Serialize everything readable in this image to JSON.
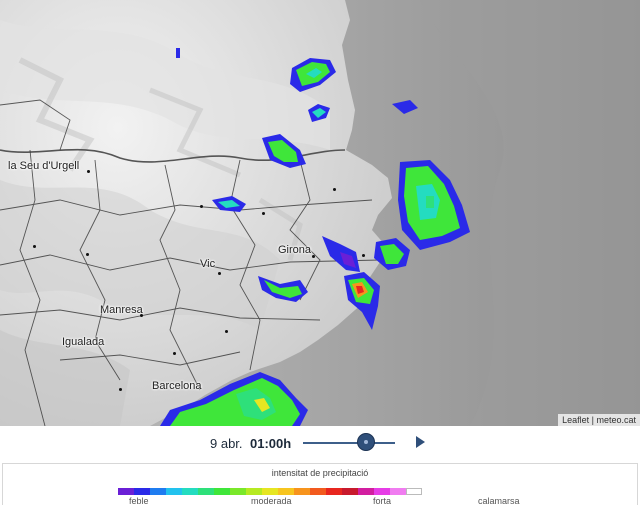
{
  "map": {
    "places": [
      {
        "id": "seu",
        "name": "la Seu d'Urgell"
      },
      {
        "id": "girona",
        "name": "Girona"
      },
      {
        "id": "vic",
        "name": "Vic"
      },
      {
        "id": "manresa",
        "name": "Manresa"
      },
      {
        "id": "igualada",
        "name": "Igualada"
      },
      {
        "id": "barcelona",
        "name": "Barcelona"
      }
    ],
    "attribution": {
      "leaflet": "Leaflet",
      "separator": "|",
      "source": "meteo.cat"
    }
  },
  "timebar": {
    "date": "9 abr.",
    "hour": "01:00h",
    "play_icon": "play-icon"
  },
  "legend": {
    "title": "intensitat de precipitació",
    "labels": {
      "low": "feble",
      "moderate": "moderada",
      "strong": "forta",
      "hail": "calamarsa"
    },
    "colors": [
      "#6a1fd6",
      "#2a2ae8",
      "#1f7cf0",
      "#22c2ee",
      "#24dcc0",
      "#2ee07a",
      "#3fe63a",
      "#7ae82a",
      "#b6ea22",
      "#e6e622",
      "#f7c51f",
      "#f7941d",
      "#f25a1e",
      "#e8261f",
      "#c81a2d",
      "#d21ea0",
      "#e63ce6",
      "#f07cf0",
      "#ffffff"
    ]
  }
}
